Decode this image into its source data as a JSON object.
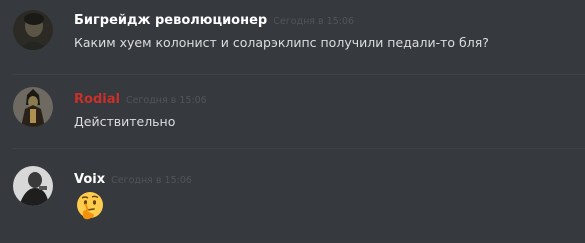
{
  "messages": [
    {
      "username": "Бигрейдж революционер",
      "timestamp": "Сегодня в 15:06",
      "content": "Каким хуем колонист и соларэклипс получили педали-то бля?",
      "name_color": "#ffffff",
      "avatar_icon": "dark-portrait-avatar"
    },
    {
      "username": "Rodial",
      "timestamp": "Сегодня в 15:06",
      "content": "Действительно",
      "name_color": "#c9302c",
      "avatar_icon": "skeleton-warrior-avatar"
    },
    {
      "username": "Voix",
      "timestamp": "Сегодня в 15:06",
      "emoji": "thinking-face-emoji",
      "name_color": "#ffffff",
      "avatar_icon": "grayscale-photo-avatar"
    }
  ]
}
